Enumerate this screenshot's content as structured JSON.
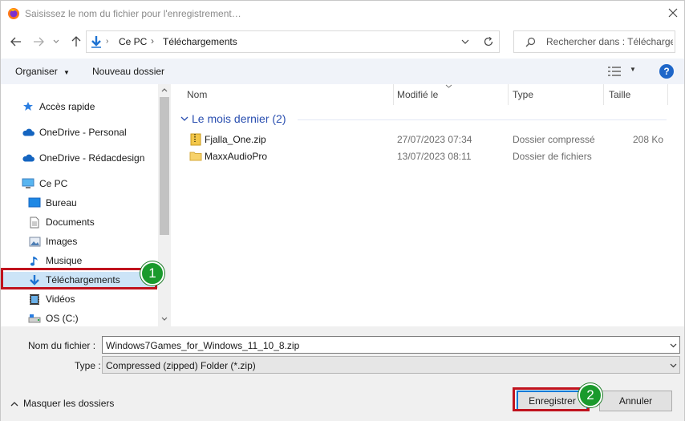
{
  "window": {
    "title": "Saisissez le nom du fichier pour l'enregistrement…"
  },
  "address": {
    "crumbs": [
      "Ce PC",
      "Téléchargements"
    ]
  },
  "search": {
    "placeholder": "Rechercher dans : Téléchargements"
  },
  "toolbar": {
    "organize": "Organiser",
    "new_folder": "Nouveau dossier"
  },
  "sidebar": {
    "items": [
      {
        "label": "Accès rapide",
        "icon": "star-icon"
      },
      {
        "label": "OneDrive - Personal",
        "icon": "cloud-icon"
      },
      {
        "label": "OneDrive - Rédacdesign",
        "icon": "cloud-icon"
      },
      {
        "label": "Ce PC",
        "icon": "computer-icon"
      },
      {
        "label": "Bureau",
        "icon": "desktop-icon"
      },
      {
        "label": "Documents",
        "icon": "document-icon"
      },
      {
        "label": "Images",
        "icon": "images-icon"
      },
      {
        "label": "Musique",
        "icon": "music-icon"
      },
      {
        "label": "Téléchargements",
        "icon": "download-icon",
        "selected": true
      },
      {
        "label": "Vidéos",
        "icon": "video-icon"
      },
      {
        "label": "OS (C:)",
        "icon": "drive-icon"
      }
    ]
  },
  "columns": {
    "name": "Nom",
    "modified": "Modifié le",
    "type": "Type",
    "size": "Taille"
  },
  "group": {
    "label": "Le mois dernier (2)"
  },
  "files": [
    {
      "name": "Fjalla_One.zip",
      "modified": "27/07/2023 07:34",
      "type": "Dossier compressé",
      "size": "208 Ko",
      "icon": "zip-folder-icon"
    },
    {
      "name": "MaxxAudioPro",
      "modified": "13/07/2023 08:11",
      "type": "Dossier de fichiers",
      "size": "",
      "icon": "folder-icon"
    }
  ],
  "form": {
    "filename_label": "Nom du fichier :",
    "filename_value": "Windows7Games_for_Windows_11_10_8.zip",
    "type_label": "Type :",
    "type_value": "Compressed (zipped) Folder (*.zip)"
  },
  "footer": {
    "hide_folders": "Masquer les dossiers",
    "save": "Enregistrer",
    "cancel": "Annuler"
  },
  "annotations": {
    "badge1": "1",
    "badge2": "2",
    "color": "#c0131e",
    "badge_color": "#1a9a2c"
  },
  "colors": {
    "accent": "#0078d7",
    "group_text": "#2a4fb0",
    "help": "#1e66c8"
  }
}
